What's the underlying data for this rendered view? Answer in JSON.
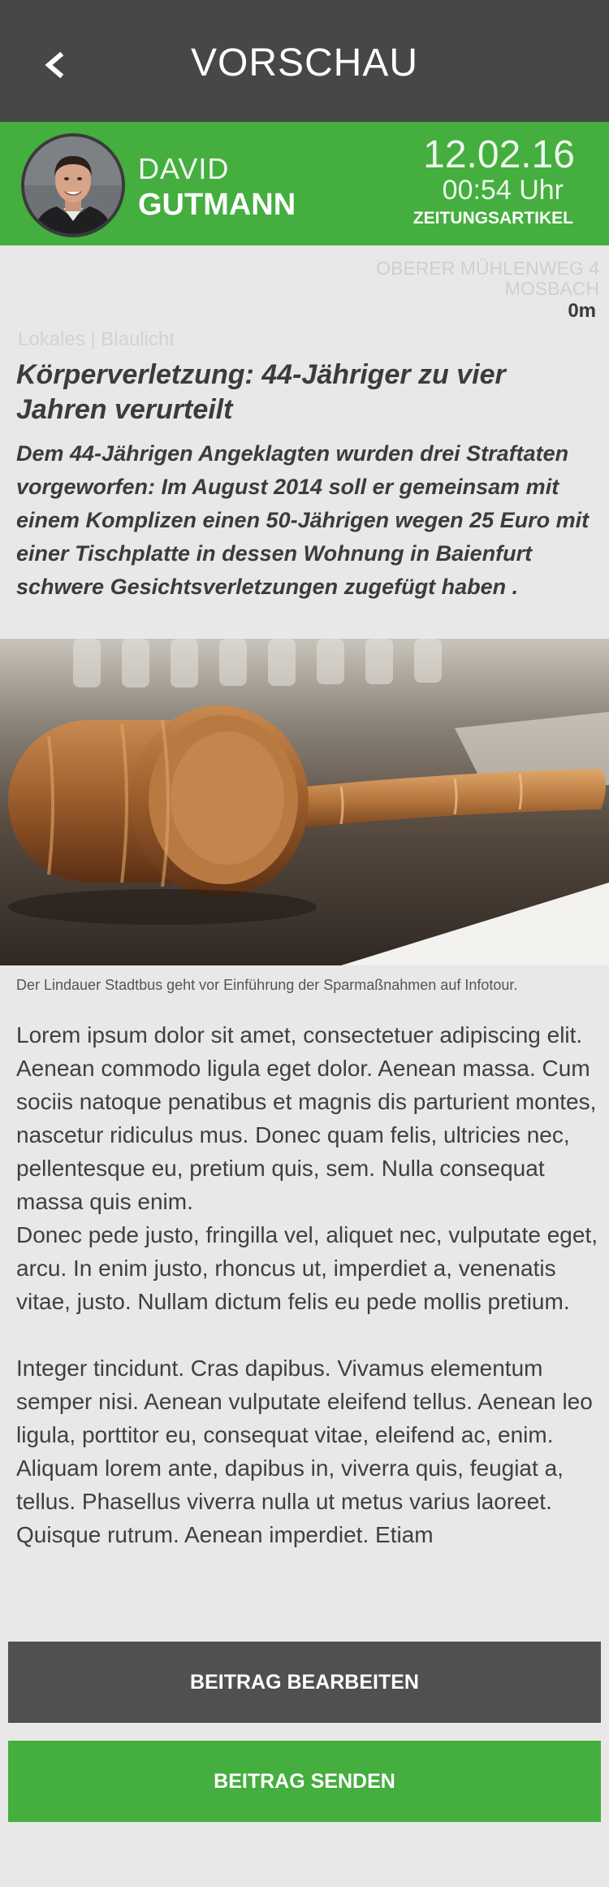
{
  "header": {
    "title": "VORSCHAU",
    "back_icon": "chevron-left-icon"
  },
  "author": {
    "first_name": "DAVID",
    "last_name": "GUTMANN",
    "date": "12.02.16",
    "time": "00:54 Uhr",
    "type": "ZEITUNGSARTIKEL",
    "accent_color": "#44ae3e"
  },
  "location": {
    "street": "OBERER MÜHLENWEG 4",
    "city": "MOSBACH",
    "distance": "0m"
  },
  "article": {
    "category": "Lokales | Blaulicht",
    "headline": "Körperverletzung: 44-Jähriger zu vier Jahren verurteilt",
    "lead": "Dem 44-Jährigen Angeklagten wurden drei Straftaten vorgeworfen: Im August 2014 soll er gemeinsam mit einem Komplizen einen 50-Jährigen wegen 25 Euro mit einer Tischplatte in dessen Wohnung in Baienfurt schwere Gesichtsverletzungen zugefügt haben .",
    "image_caption": "Der Lindauer Stadtbus geht vor Einführung der Sparmaßnahmen auf Infotour.",
    "body_p1": "Lorem ipsum dolor sit amet, consectetuer adipiscing elit. Aenean commodo ligula eget dolor. Aenean massa. Cum sociis natoque penatibus et magnis dis parturient montes, nascetur ridiculus mus. Donec quam felis, ultricies nec, pellentesque eu, pretium quis, sem. Nulla consequat massa quis enim.",
    "body_p2": "Donec pede justo, fringilla vel, aliquet nec, vulputate eget, arcu. In enim justo, rhoncus ut, imperdiet a, venenatis vitae, justo. Nullam dictum felis eu pede mollis pretium.",
    "body_p3": "Integer tincidunt. Cras dapibus. Vivamus elementum semper nisi. Aenean vulputate eleifend tellus. Aenean leo ligula, porttitor eu, consequat vitae, eleifend ac, enim. Aliquam lorem ante, dapibus in, viverra quis, feugiat a, tellus. Phasellus viverra nulla ut metus varius laoreet. Quisque rutrum. Aenean imperdiet. Etiam"
  },
  "actions": {
    "edit_label": "BEITRAG BEARBEITEN",
    "send_label": "BEITRAG SENDEN",
    "edit_color": "#505050",
    "send_color": "#44ae3e"
  }
}
